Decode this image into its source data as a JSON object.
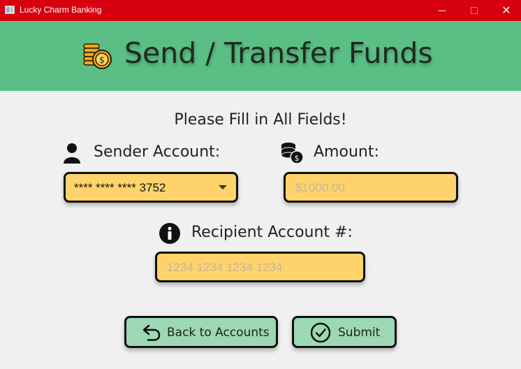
{
  "window": {
    "title": "Lucky Charm Banking",
    "minimize_glyph": "—",
    "close_glyph": "✕"
  },
  "header": {
    "title": "Send / Transfer Funds",
    "icon": "coins-icon"
  },
  "form": {
    "instruction": "Please Fill in All Fields!",
    "sender": {
      "label": "Sender Account:",
      "icon": "user-icon",
      "selected_value": "**** **** **** 3752"
    },
    "amount": {
      "label": "Amount:",
      "icon": "coin-stack-icon",
      "placeholder": "$1000.00",
      "value": ""
    },
    "recipient": {
      "label": "Recipient Account #:",
      "icon": "info-icon",
      "placeholder": "1234 1234 1234 1234",
      "value": ""
    }
  },
  "buttons": {
    "back_label": "Back to Accounts",
    "back_icon": "return-arrow-icon",
    "submit_label": "Submit",
    "submit_icon": "check-circle-icon"
  },
  "colors": {
    "titlebar": "#d7000f",
    "banner": "#5bbf85",
    "field_bg": "#ffd36b",
    "button_bg": "#9bd8b3"
  }
}
